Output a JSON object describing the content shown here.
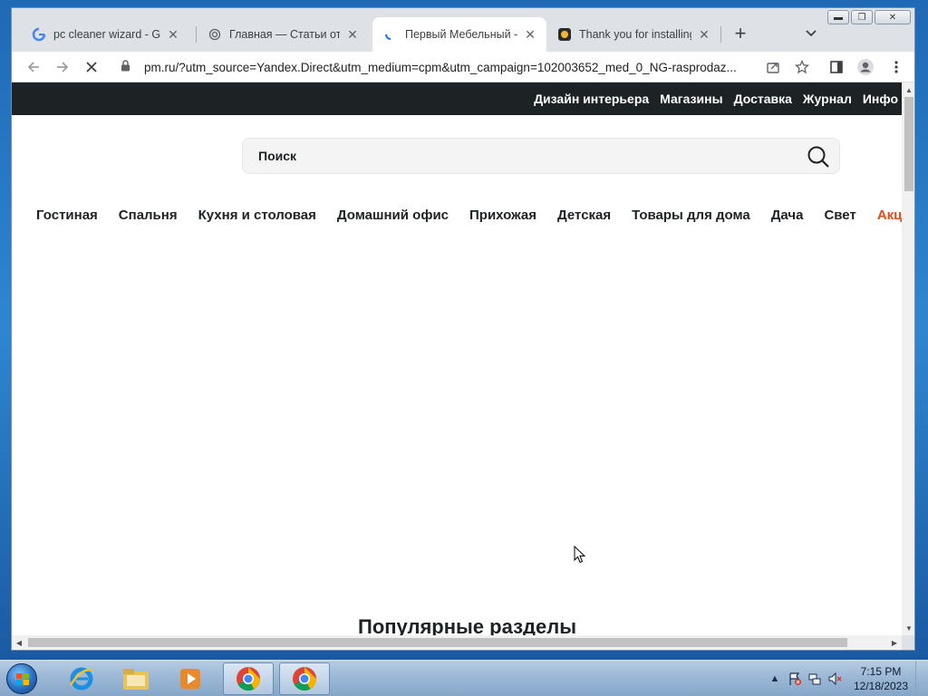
{
  "tabs": [
    {
      "title": "pc cleaner wizard - Goo",
      "icon": "google-icon"
    },
    {
      "title": "Главная — Статьи от Ch",
      "icon": "openai-icon"
    },
    {
      "title": "Первый Мебельный - т",
      "icon": "loading-spinner-icon"
    },
    {
      "title": "Thank you for installing",
      "icon": "extension-icon"
    }
  ],
  "active_tab": 2,
  "address_bar": {
    "url": "pm.ru/?utm_source=Yandex.Direct&utm_medium=cpm&utm_campaign=102003652_med_0_NG-rasprodaz..."
  },
  "site": {
    "top_links": [
      "Дизайн интерьера",
      "Магазины",
      "Доставка",
      "Журнал",
      "Инфо"
    ],
    "search_placeholder": "Поиск",
    "categories": [
      "Гостиная",
      "Спальня",
      "Кухня и столовая",
      "Домашний офис",
      "Прихожая",
      "Детская",
      "Товары для дома",
      "Дача",
      "Свет",
      "Акции"
    ],
    "popular_heading": "Популярные разделы"
  },
  "taskbar": {
    "clock_time": "7:15 PM",
    "clock_date": "12/18/2023"
  },
  "colors": {
    "topbar": "#1d2225",
    "sale": "#e8491d",
    "taskbar": "#9cb8d6"
  }
}
